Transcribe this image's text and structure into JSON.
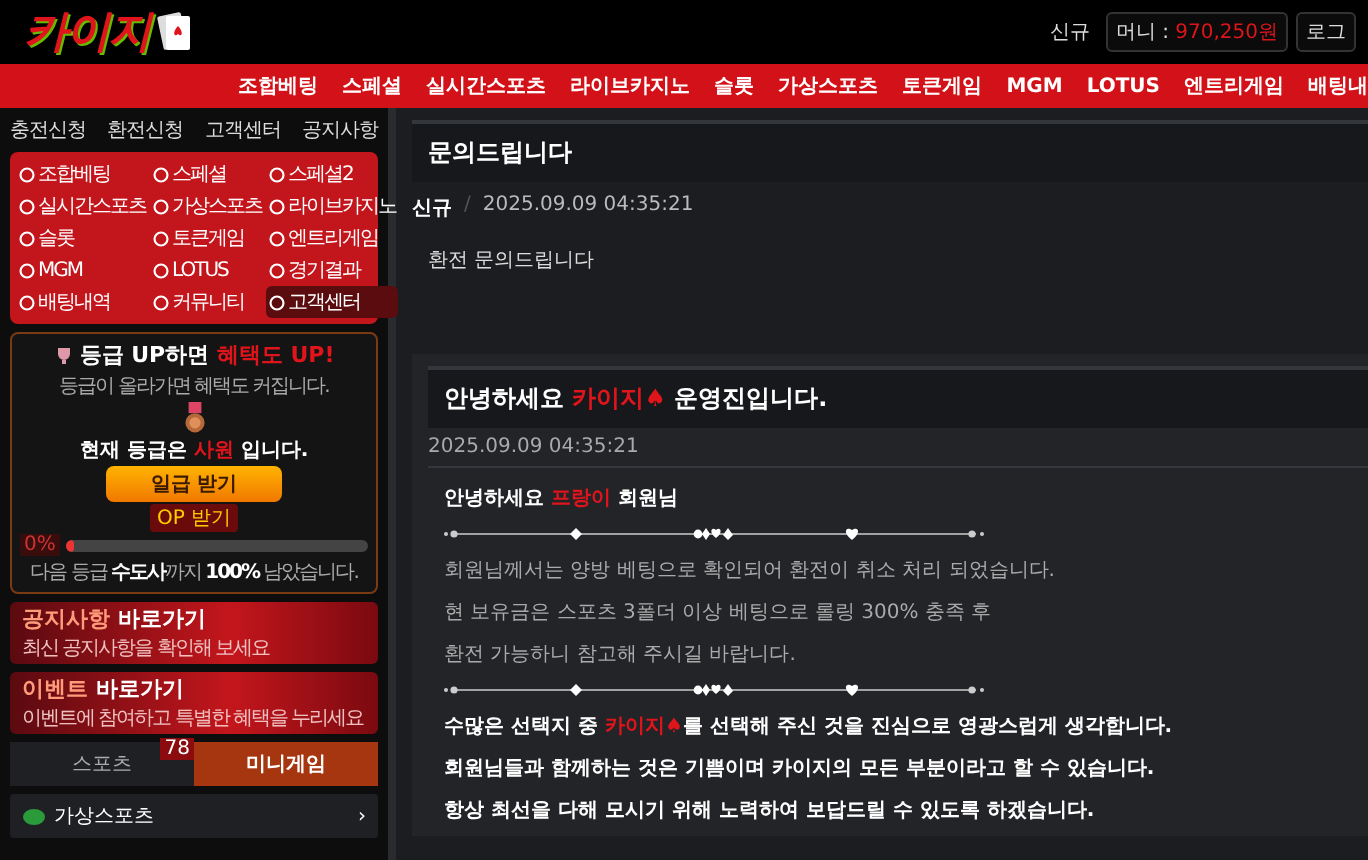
{
  "header": {
    "logo": "카이지",
    "links": [
      {
        "label": "신규"
      },
      {
        "label": "머니 : ",
        "value": "970,250원"
      },
      {
        "label": "로그"
      }
    ]
  },
  "nav": [
    "조합베팅",
    "스페셜",
    "실시간스포츠",
    "라이브카지노",
    "슬롯",
    "가상스포츠",
    "토큰게임",
    "MGM",
    "LOTUS",
    "엔트리게임",
    "배팅내"
  ],
  "sidebar": {
    "quick_links": [
      "충전신청",
      "환전신청",
      "고객센터",
      "공지사항"
    ],
    "menu": [
      {
        "label": "조합베팅",
        "selected": false
      },
      {
        "label": "스페셜",
        "selected": false
      },
      {
        "label": "스페셜2",
        "selected": false
      },
      {
        "label": "실시간스포츠",
        "selected": false
      },
      {
        "label": "가상스포츠",
        "selected": false
      },
      {
        "label": "라이브카지노",
        "selected": false
      },
      {
        "label": "슬롯",
        "selected": false
      },
      {
        "label": "토큰게임",
        "selected": false
      },
      {
        "label": "엔트리게임",
        "selected": false
      },
      {
        "label": "MGM",
        "selected": false
      },
      {
        "label": "LOTUS",
        "selected": false
      },
      {
        "label": "경기결과",
        "selected": false
      },
      {
        "label": "배팅내역",
        "selected": false
      },
      {
        "label": "커뮤니티",
        "selected": false
      },
      {
        "label": "고객센터",
        "selected": true
      }
    ],
    "grade": {
      "title": [
        {
          "text": "등급 UP하면 ",
          "accent": false
        },
        {
          "text": "혜택도 UP!",
          "accent": true
        }
      ],
      "subtitle": "등급이 올라가면 혜택도 커집니다.",
      "current": [
        {
          "text": "현재 등급은 ",
          "accent": false
        },
        {
          "text": "사원",
          "accent": true
        },
        {
          "text": " 입니다.",
          "accent": false
        }
      ],
      "button": "일급 받기",
      "badge": "OP 받기",
      "percent": "0%",
      "level": 0,
      "next": "다음 등급 **수도사**까지 **100%** 남았습니다."
    },
    "banners": [
      {
        "title": "공지사항",
        "action": "바로가기",
        "subtitle": "최신 공지사항을 확인해 보세요"
      },
      {
        "title": "이벤트",
        "action": "바로가기",
        "subtitle": "이벤트에 참여하고 특별한 혜택을 누리세요"
      }
    ],
    "tabs": [
      {
        "label": "스포츠",
        "badge": "78",
        "selected": false
      },
      {
        "label": "미니게임",
        "selected": true
      }
    ],
    "items": [
      {
        "label": "가상스포츠",
        "arrow": "›"
      }
    ]
  },
  "post": {
    "title": "문의드립니다",
    "status": "신규",
    "separator": "/",
    "date": "2025.09.09 04:35:21",
    "body": "환전 문의드립니다"
  },
  "reply": {
    "title": [
      {
        "text": "안녕하세요 ",
        "accent": false
      },
      {
        "text": "카이지♠",
        "accent": true
      },
      {
        "text": " 운영진입니다.",
        "accent": false
      }
    ],
    "date": "2025.09.09 04:35:21",
    "lines": [
      {
        "kind": "strong",
        "parts": [
          {
            "text": "안녕하세요 ",
            "accent": false
          },
          {
            "text": "프랑이",
            "accent": true
          },
          {
            "text": " 회원님",
            "accent": false
          }
        ]
      },
      {
        "kind": "divider"
      },
      {
        "kind": "text",
        "parts": [
          {
            "text": "회원님께서는 양방 베팅으로 확인되어 환전이 취소 처리 되었습니다.",
            "accent": false
          }
        ]
      },
      {
        "kind": "text",
        "parts": [
          {
            "text": "현 보유금은 스포츠 3폴더 이상 베팅으로 롤링 300% 충족 후",
            "accent": false
          }
        ]
      },
      {
        "kind": "text",
        "parts": [
          {
            "text": "환전 가능하니 참고해 주시길 바랍니다.",
            "accent": false
          }
        ]
      },
      {
        "kind": "divider"
      },
      {
        "kind": "strong",
        "parts": [
          {
            "text": "수많은 선택지 중 ",
            "accent": false
          },
          {
            "text": "카이지♠",
            "accent": true
          },
          {
            "text": "를 선택해 주신 것을 진심으로 영광스럽게 생각합니다.",
            "accent": false
          }
        ]
      },
      {
        "kind": "strong",
        "parts": [
          {
            "text": "회원님들과 함께하는 것은 기쁨이며 카이지의 모든 부분이라고 할 수 있습니다.",
            "accent": false
          }
        ]
      },
      {
        "kind": "strong",
        "parts": [
          {
            "text": "항상 최선을 다해 모시기 위해 노력하여 보답드릴 수 있도록 하겠습니다.",
            "accent": false
          }
        ]
      }
    ]
  }
}
